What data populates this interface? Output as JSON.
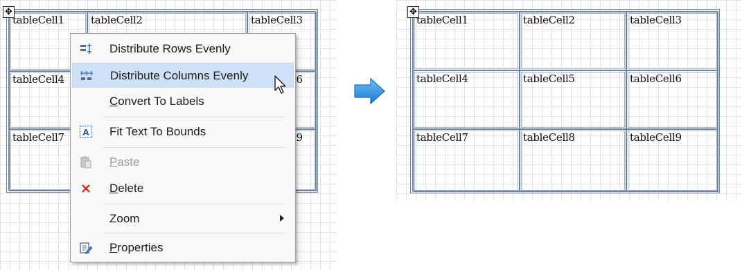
{
  "before": {
    "cells": [
      [
        "tableCell1",
        "tableCell2",
        "tableCell3"
      ],
      [
        "tableCell4",
        "tableCell5",
        "tableCell6"
      ],
      [
        "tableCell7",
        "tableCell8",
        "tableCell9"
      ]
    ]
  },
  "after": {
    "cells": [
      [
        "tableCell1",
        "tableCell2",
        "tableCell3"
      ],
      [
        "tableCell4",
        "tableCell5",
        "tableCell6"
      ],
      [
        "tableCell7",
        "tableCell8",
        "tableCell9"
      ]
    ]
  },
  "context_menu": {
    "items": [
      {
        "label": "Distribute Rows Evenly",
        "icon": "distribute-rows-icon",
        "mnemonic": ""
      },
      {
        "label": "Distribute Columns Evenly",
        "icon": "distribute-columns-icon",
        "mnemonic": "",
        "highlighted": true
      },
      {
        "label": "Convert To Labels",
        "icon": "",
        "mnemonic": "C"
      },
      {
        "label": "Fit Text To Bounds",
        "icon": "fit-text-icon",
        "mnemonic": ""
      },
      {
        "label": "Paste",
        "icon": "paste-icon",
        "mnemonic": "P",
        "disabled": true
      },
      {
        "label": "Delete",
        "icon": "delete-icon",
        "mnemonic": "D"
      },
      {
        "label": "Zoom",
        "icon": "",
        "mnemonic": "",
        "submenu": true
      },
      {
        "label": "Properties",
        "icon": "properties-icon",
        "mnemonic": "P"
      }
    ]
  },
  "colors": {
    "table_border": "#6c7fa8",
    "menu_highlight": "#cfe1f6",
    "arrow": "#2f8fe0",
    "delete_icon": "#c8321e"
  }
}
